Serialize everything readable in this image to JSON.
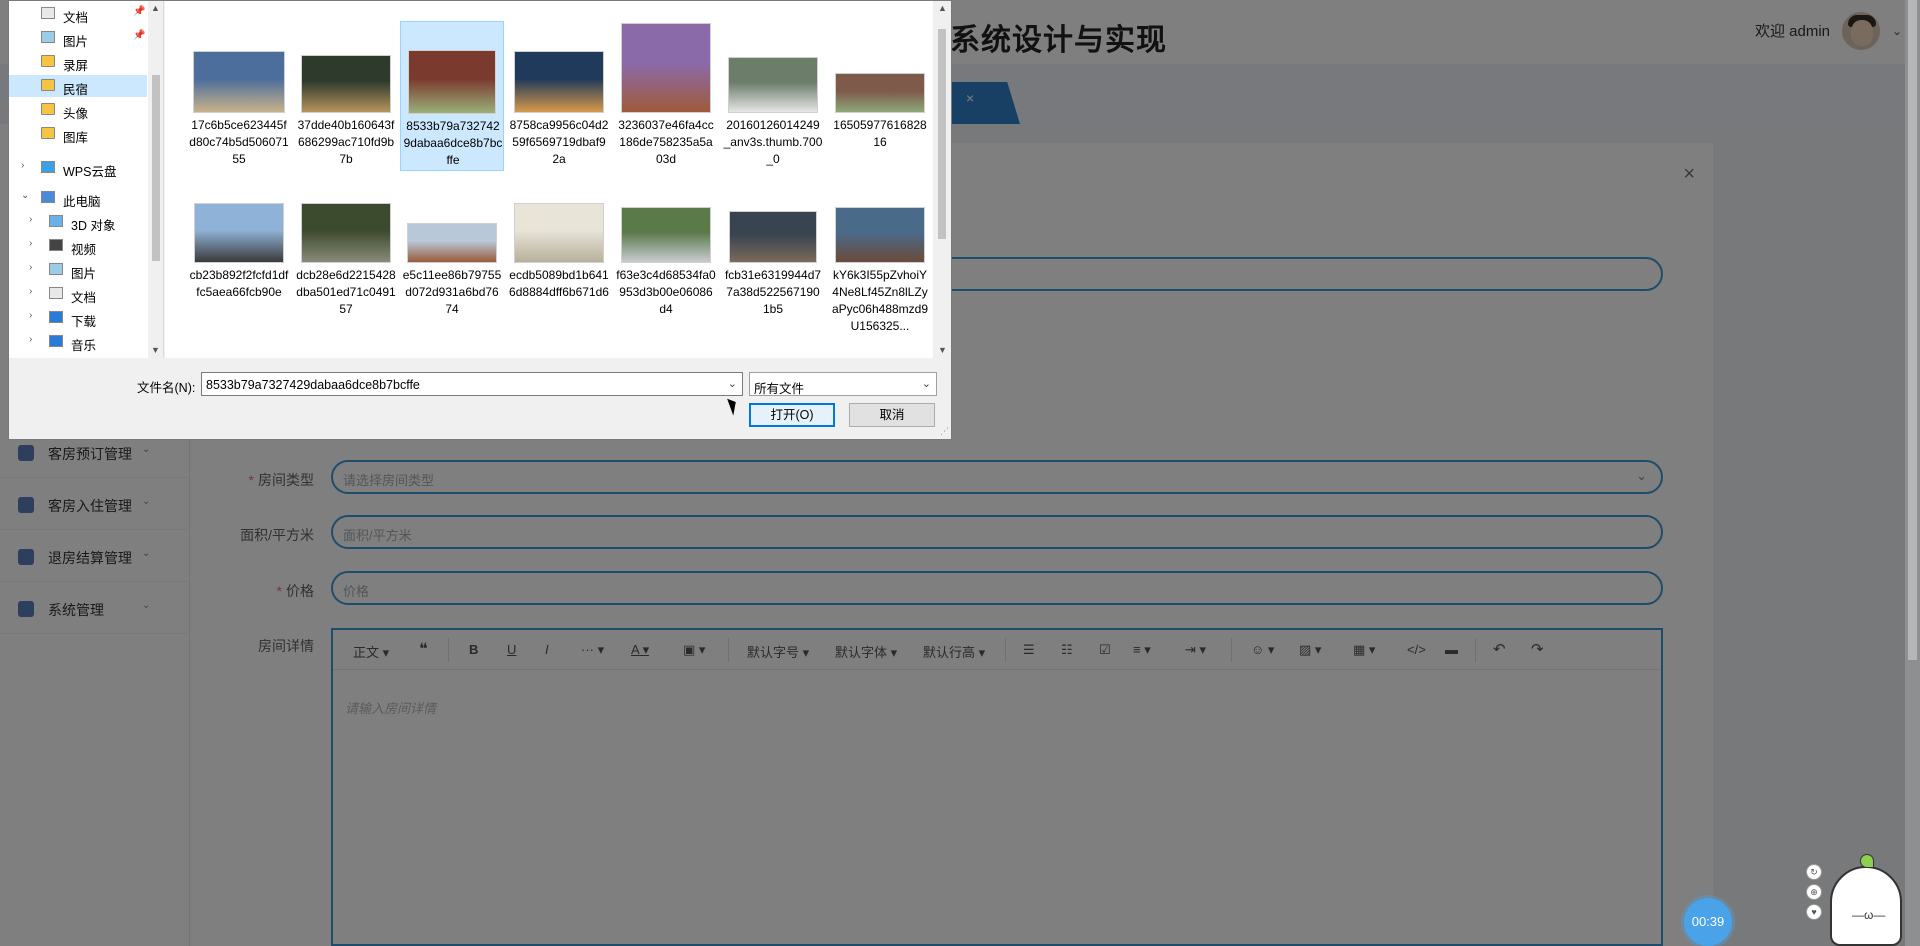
{
  "app": {
    "system_title": "系统设计与实现",
    "welcome": "欢迎 admin",
    "tab_close": "×",
    "sidebar": [
      {
        "label": "客房预订管理"
      },
      {
        "label": "客房入住管理"
      },
      {
        "label": "退房结算管理"
      },
      {
        "label": "系统管理"
      }
    ]
  },
  "modal": {
    "close": "×",
    "fields": [
      {
        "label": "房间类型",
        "required": true,
        "placeholder": "请选择房间类型",
        "type": "select"
      },
      {
        "label": "面积/平方米",
        "required": false,
        "placeholder": "面积/平方米",
        "type": "text"
      },
      {
        "label": "价格",
        "required": true,
        "placeholder": "价格",
        "type": "text"
      }
    ],
    "editor_label": "房间详情",
    "editor_placeholder": "请输入房间详情",
    "toolbar": {
      "paragraph": "正文",
      "font_size": "默认字号",
      "font_family": "默认字体",
      "line_height": "默认行高"
    }
  },
  "dialog": {
    "nav_items": [
      {
        "label": "文档",
        "pinned": true,
        "icon": "document-icon"
      },
      {
        "label": "图片",
        "pinned": true,
        "icon": "picture-icon"
      },
      {
        "label": "录屏",
        "icon": "folder-icon"
      },
      {
        "label": "民宿",
        "icon": "folder-icon",
        "selected": true
      },
      {
        "label": "头像",
        "icon": "folder-icon"
      },
      {
        "label": "图库",
        "icon": "folder-icon"
      },
      {
        "label": "WPS云盘",
        "icon": "cloud-icon"
      },
      {
        "label": "此电脑",
        "icon": "computer-icon"
      },
      {
        "label": "3D 对象",
        "icon": "cube-icon"
      },
      {
        "label": "视频",
        "icon": "video-icon"
      },
      {
        "label": "图片",
        "icon": "picture-icon"
      },
      {
        "label": "文档",
        "icon": "document-icon"
      },
      {
        "label": "下载",
        "icon": "download-icon"
      },
      {
        "label": "音乐",
        "icon": "music-icon"
      }
    ],
    "files": [
      {
        "name": "17c6b5ce623445fd80c74b5d50607155",
        "selected": false,
        "c1": "#4c6e9c",
        "c2": "#c8b28a"
      },
      {
        "name": "37dde40b160643f686299ac710fd9b7b",
        "selected": false,
        "c1": "#2e3b2c",
        "c2": "#b6945e"
      },
      {
        "name": "8533b79a7327429dabaa6dce8b7bcffe",
        "selected": true,
        "c1": "#7a3a2e",
        "c2": "#9ab07a"
      },
      {
        "name": "8758ca9956c04d259f6569719dbaf92a",
        "selected": false,
        "c1": "#1f3a5a",
        "c2": "#d89a4a"
      },
      {
        "name": "3236037e46fa4cc186de758235a5a03d",
        "selected": false,
        "c1": "#8a6aa8",
        "c2": "#a05a3a"
      },
      {
        "name": "20160126014249_anv3s.thumb.700_0",
        "selected": false,
        "c1": "#6c7d6a",
        "c2": "#e6e6e6"
      },
      {
        "name": "1650597761682816",
        "selected": false,
        "c1": "#7d5a4a",
        "c2": "#8ea87a"
      },
      {
        "name": "cb23b892f2fcfd1dffc5aea66fcb90e",
        "selected": false,
        "c1": "#8fb3d8",
        "c2": "#3a3a3a"
      },
      {
        "name": "dcb28e6d2215428dba501ed71c049157",
        "selected": false,
        "c1": "#3c4a2e",
        "c2": "#8a8a7a"
      },
      {
        "name": "e5c11ee86b79755d072d931a6bd7674",
        "selected": false,
        "c1": "#b8c8d8",
        "c2": "#9a5a3a"
      },
      {
        "name": "ecdb5089bd1b6416d8884dff6b671d6",
        "selected": false,
        "c1": "#e8e4d8",
        "c2": "#b8b09a"
      },
      {
        "name": "f63e3c4d68534fa0953d3b00e06086d4",
        "selected": false,
        "c1": "#5a7a4a",
        "c2": "#c8ccd0"
      },
      {
        "name": "fcb31e6319944d77a38d5225671901b5",
        "selected": false,
        "c1": "#3a4450",
        "c2": "#7a6a5a"
      },
      {
        "name": "kY6k3I55pZvhoiY4Ne8Lf45Zn8lLZyaPyc06h488mzd9U156325...",
        "selected": false,
        "c1": "#4a6a8a",
        "c2": "#6a4a3a"
      }
    ],
    "filename_label": "文件名(N):",
    "filename_value": "8533b79a7327429dabaa6dce8b7bcffe",
    "filetype_value": "所有文件",
    "open_label": "打开(O)",
    "cancel_label": "取消"
  },
  "timer": "00:39"
}
